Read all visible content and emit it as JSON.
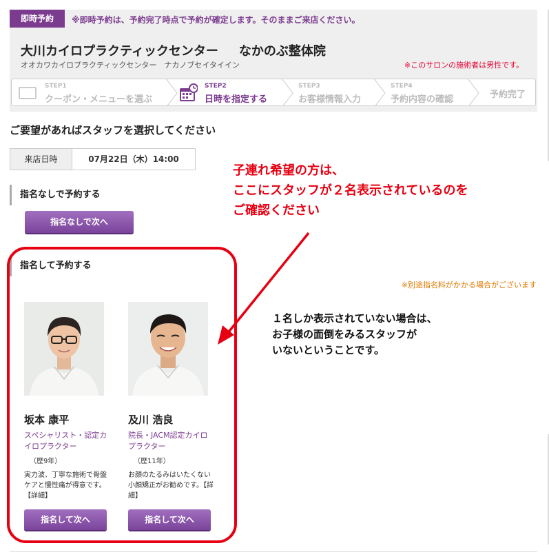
{
  "header": {
    "badge": "即時予約",
    "instant_note": "※即時予約は、予約完了時点で予約が確定します。そのままご来店ください。",
    "salon_name": "大川カイロプラクティックセンター",
    "salon_sub": "なかのぶ整体院",
    "salon_kana": "オオカワカイロプラクティックセンター　ナカノブセイタイイン",
    "male_note": "※このサロンの施術者は男性です。"
  },
  "steps": [
    {
      "label": "STEP1",
      "text": "クーポン・メニューを選ぶ"
    },
    {
      "label": "STEP2",
      "text": "日時を指定する"
    },
    {
      "label": "STEP3",
      "text": "お客様情報入力"
    },
    {
      "label": "STEP4",
      "text": "予約内容の確認"
    },
    {
      "label": "",
      "text": "予約完了"
    }
  ],
  "section_title": "ご要望があればスタッフを選択してください",
  "visit": {
    "label": "来店日時",
    "value": "07月22日（木）14:00"
  },
  "no_nomination": {
    "heading": "指名なしで予約する",
    "button": "指名なしで次へ"
  },
  "nomination": {
    "heading": "指名して予約する",
    "extra_fee": "※別途指名料がかかる場合がございます"
  },
  "staff": [
    {
      "name": "坂本 康平",
      "title": "スペシャリスト・認定カイロプラクター",
      "years": "（歴9年）",
      "desc": "実力波、丁寧な施術で骨盤ケアと慢性痛が得意です。【詳細】",
      "button": "指名して次へ"
    },
    {
      "name": "及川 浩良",
      "title": "院長・JACM認定カイロプラクター",
      "years": "（歴11年）",
      "desc": "お顔のたるみはいたくない小顔矯正がお勧めです。【詳細】",
      "button": "指名して次へ"
    }
  ],
  "annotations": {
    "red_line1": "子連れ希望の方は、",
    "red_line2": "ここにスタッフが２名表示されているのを",
    "red_line3": "ご確認ください",
    "black_line1": "１名しか表示されていない場合は、",
    "black_line2": "お子様の面倒をみるスタッフが",
    "black_line3": "いないということです。"
  },
  "colors": {
    "accent": "#7b3b8f",
    "alert_red": "#e60012",
    "notice_orange": "#e07b00"
  }
}
